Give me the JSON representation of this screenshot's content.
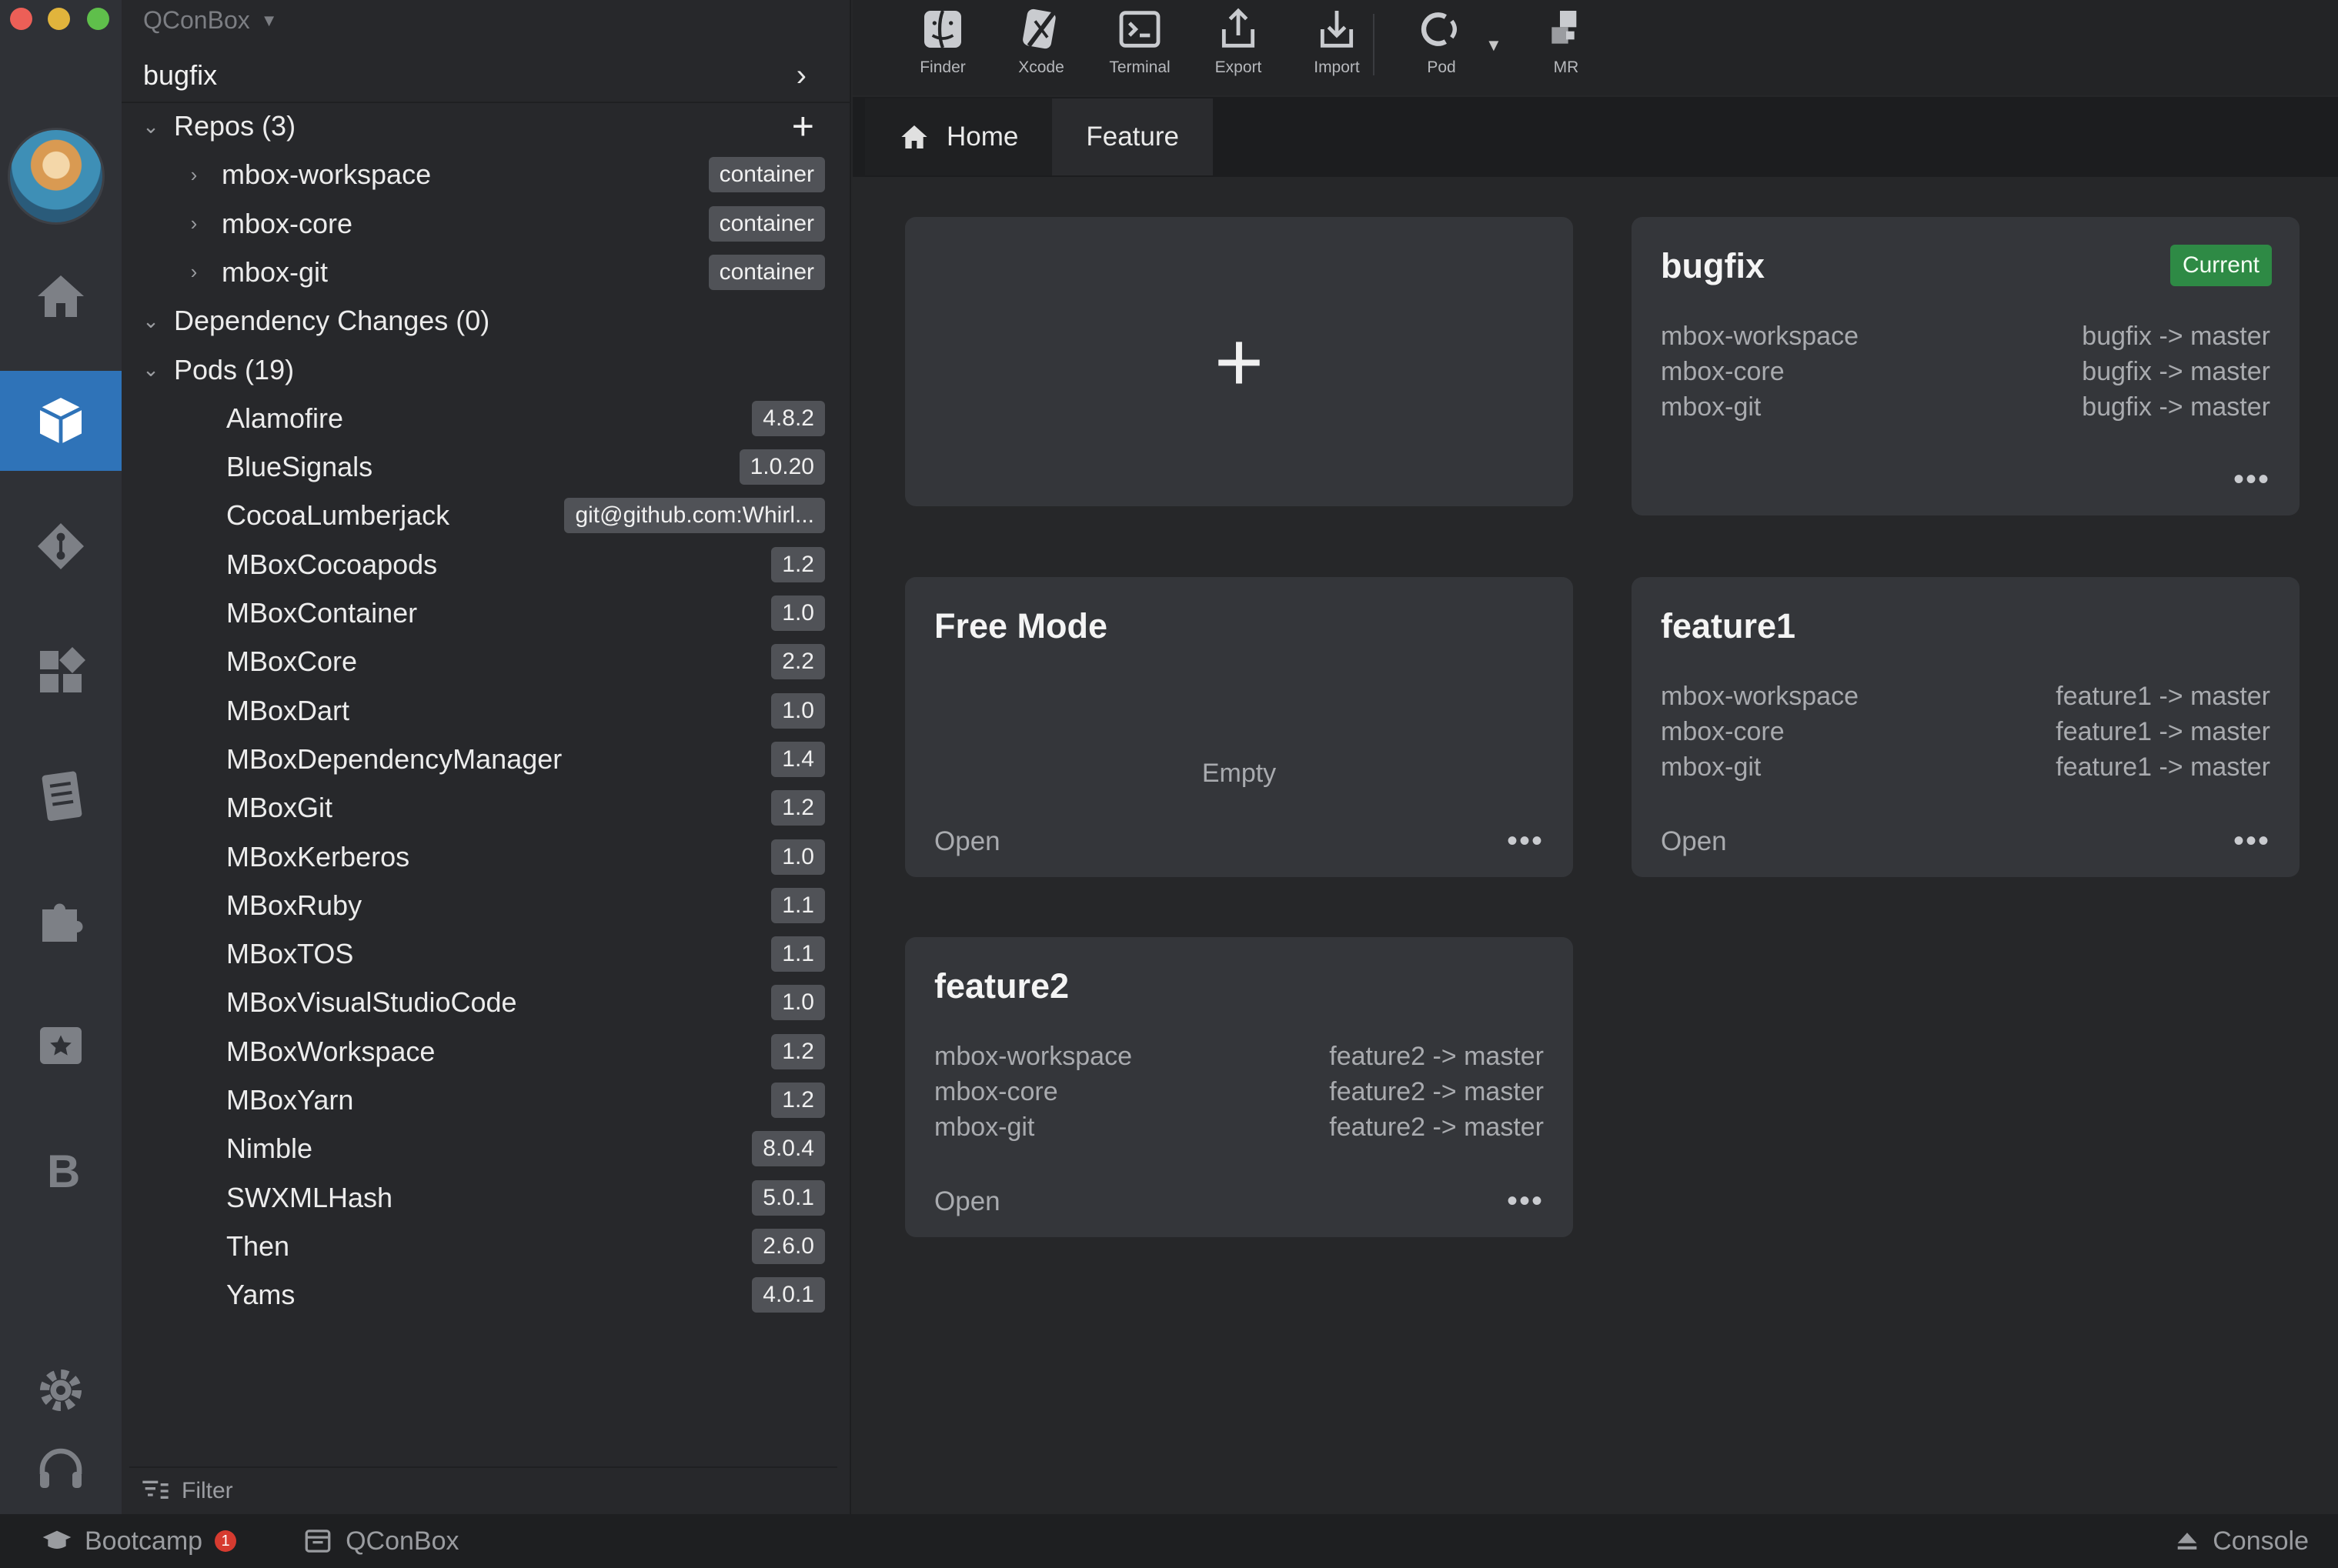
{
  "app": {
    "title": "QConBox"
  },
  "workspace": {
    "name": "bugfix"
  },
  "sections": {
    "repos": {
      "label": "Repos (3)"
    },
    "dependency_changes": {
      "label": "Dependency Changes (0)"
    },
    "pods": {
      "label": "Pods (19)"
    }
  },
  "repos": [
    {
      "name": "mbox-workspace",
      "tag": "container"
    },
    {
      "name": "mbox-core",
      "tag": "container"
    },
    {
      "name": "mbox-git",
      "tag": "container"
    }
  ],
  "pods": [
    {
      "name": "Alamofire",
      "version": "4.8.2"
    },
    {
      "name": "BlueSignals",
      "version": "1.0.20"
    },
    {
      "name": "CocoaLumberjack",
      "version": "git@github.com:Whirl..."
    },
    {
      "name": "MBoxCocoapods",
      "version": "1.2"
    },
    {
      "name": "MBoxContainer",
      "version": "1.0"
    },
    {
      "name": "MBoxCore",
      "version": "2.2"
    },
    {
      "name": "MBoxDart",
      "version": "1.0"
    },
    {
      "name": "MBoxDependencyManager",
      "version": "1.4"
    },
    {
      "name": "MBoxGit",
      "version": "1.2"
    },
    {
      "name": "MBoxKerberos",
      "version": "1.0"
    },
    {
      "name": "MBoxRuby",
      "version": "1.1"
    },
    {
      "name": "MBoxTOS",
      "version": "1.1"
    },
    {
      "name": "MBoxVisualStudioCode",
      "version": "1.0"
    },
    {
      "name": "MBoxWorkspace",
      "version": "1.2"
    },
    {
      "name": "MBoxYarn",
      "version": "1.2"
    },
    {
      "name": "Nimble",
      "version": "8.0.4"
    },
    {
      "name": "SWXMLHash",
      "version": "5.0.1"
    },
    {
      "name": "Then",
      "version": "2.6.0"
    },
    {
      "name": "Yams",
      "version": "4.0.1"
    }
  ],
  "filter": {
    "placeholder": "Filter"
  },
  "toolbar": {
    "finder": "Finder",
    "xcode": "Xcode",
    "terminal": "Terminal",
    "export": "Export",
    "import": "Import",
    "pod": "Pod",
    "mr": "MR"
  },
  "tabs": {
    "home": "Home",
    "feature": "Feature"
  },
  "cards": {
    "bugfix": {
      "title": "bugfix",
      "badge": "Current",
      "rows": [
        {
          "repo": "mbox-workspace",
          "branch": "bugfix -> master"
        },
        {
          "repo": "mbox-core",
          "branch": "bugfix -> master"
        },
        {
          "repo": "mbox-git",
          "branch": "bugfix -> master"
        }
      ],
      "more": "•••"
    },
    "free_mode": {
      "title": "Free Mode",
      "empty": "Empty",
      "open": "Open",
      "more": "•••"
    },
    "feature1": {
      "title": "feature1",
      "rows": [
        {
          "repo": "mbox-workspace",
          "branch": "feature1 -> master"
        },
        {
          "repo": "mbox-core",
          "branch": "feature1 -> master"
        },
        {
          "repo": "mbox-git",
          "branch": "feature1 -> master"
        }
      ],
      "open": "Open",
      "more": "•••"
    },
    "feature2": {
      "title": "feature2",
      "rows": [
        {
          "repo": "mbox-workspace",
          "branch": "feature2 -> master"
        },
        {
          "repo": "mbox-core",
          "branch": "feature2 -> master"
        },
        {
          "repo": "mbox-git",
          "branch": "feature2 -> master"
        }
      ],
      "open": "Open",
      "more": "•••"
    },
    "add": {
      "symbol": "+"
    }
  },
  "statusbar": {
    "bootcamp": "Bootcamp",
    "bootcamp_badge": "1",
    "qconbox": "QConBox",
    "console": "Console"
  },
  "colors": {
    "accent": "#2f73b8",
    "current_badge": "#2e8a45",
    "background": "#262729",
    "card": "#34363a"
  }
}
